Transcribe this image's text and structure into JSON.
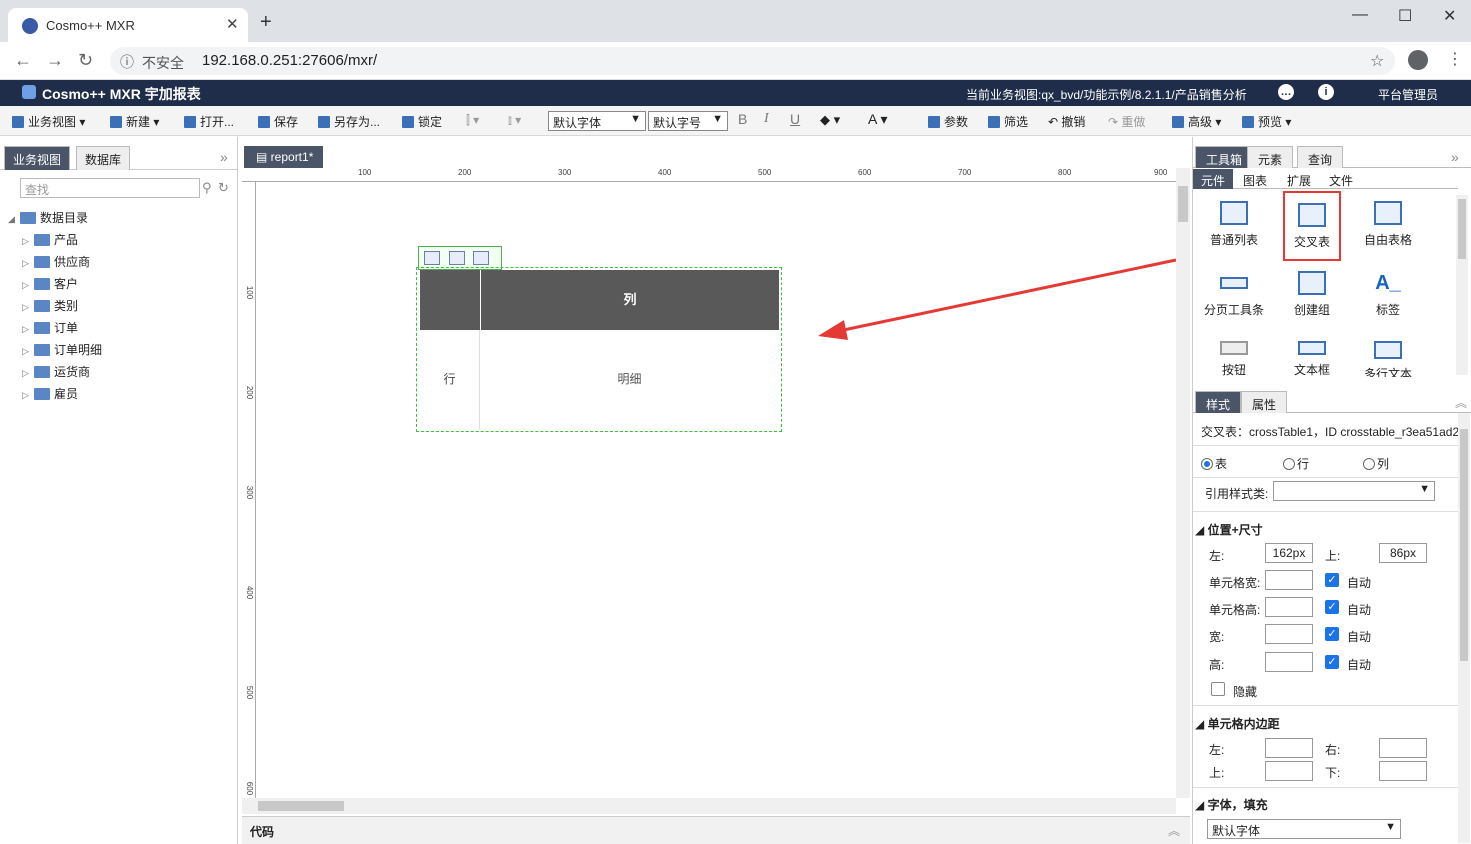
{
  "browser": {
    "tab_title": "Cosmo++ MXR",
    "insecure_label": "不安全",
    "url": "192.168.0.251:27606/mxr/"
  },
  "header": {
    "app_name": "Cosmo++ MXR 宇加报表",
    "current_view": "当前业务视图:qx_bvd/功能示例/8.2.1.1/产品销售分析",
    "user": "平台管理员"
  },
  "toolbar": {
    "business_view": "业务视图",
    "new": "新建",
    "open": "打开...",
    "save": "保存",
    "save_as": "另存为...",
    "lock": "锁定",
    "font_family": "默认字体",
    "font_size": "默认字号",
    "bold": "B",
    "italic": "I",
    "underline": "U",
    "font_color": "A",
    "params": "参数",
    "filter": "筛选",
    "undo": "撤销",
    "redo": "重做",
    "advanced": "高级",
    "preview": "预览"
  },
  "left_panel": {
    "tabs": [
      "业务视图",
      "数据库"
    ],
    "search_placeholder": "查找",
    "tree_root": "数据目录",
    "tree_items": [
      "产品",
      "供应商",
      "客户",
      "类别",
      "订单",
      "订单明细",
      "运货商",
      "雇员"
    ]
  },
  "editor": {
    "doc_tab": "report1*",
    "ruler_h": [
      "100",
      "200",
      "300",
      "400",
      "500",
      "600",
      "700",
      "800",
      "900"
    ],
    "ruler_v": [
      "100",
      "200",
      "300",
      "400",
      "500",
      "600"
    ],
    "cross_table": {
      "col_header": "列",
      "row_header": "行",
      "detail": "明细"
    },
    "code_label": "代码"
  },
  "right_panel": {
    "tabs": [
      "工具箱",
      "元素",
      "查询"
    ],
    "sub_tabs": [
      "元件",
      "图表",
      "扩展",
      "文件"
    ],
    "components": [
      "普通列表",
      "交叉表",
      "自由表格",
      "分页工具条",
      "创建组",
      "标签",
      "按钮",
      "文本框",
      "多行文本"
    ],
    "style_tabs": [
      "样式",
      "属性"
    ],
    "selected_label": "交叉表：crossTable1，ID crosstable_r3ea51ad2",
    "radios": [
      "表",
      "行",
      "列"
    ],
    "style_class_label": "引用样式类:",
    "section_position": "位置+尺寸",
    "left_label": "左:",
    "left_value": "162px",
    "top_label": "上:",
    "top_value": "86px",
    "cell_width_label": "单元格宽:",
    "cell_height_label": "单元格高:",
    "width_label": "宽:",
    "height_label": "高:",
    "auto_label": "自动",
    "hidden_label": "隐藏",
    "section_padding": "单元格内边距",
    "pad_left": "左:",
    "pad_right": "右:",
    "pad_top": "上:",
    "pad_bottom": "下:",
    "section_font": "字体，填充",
    "font_select": "默认字体"
  }
}
